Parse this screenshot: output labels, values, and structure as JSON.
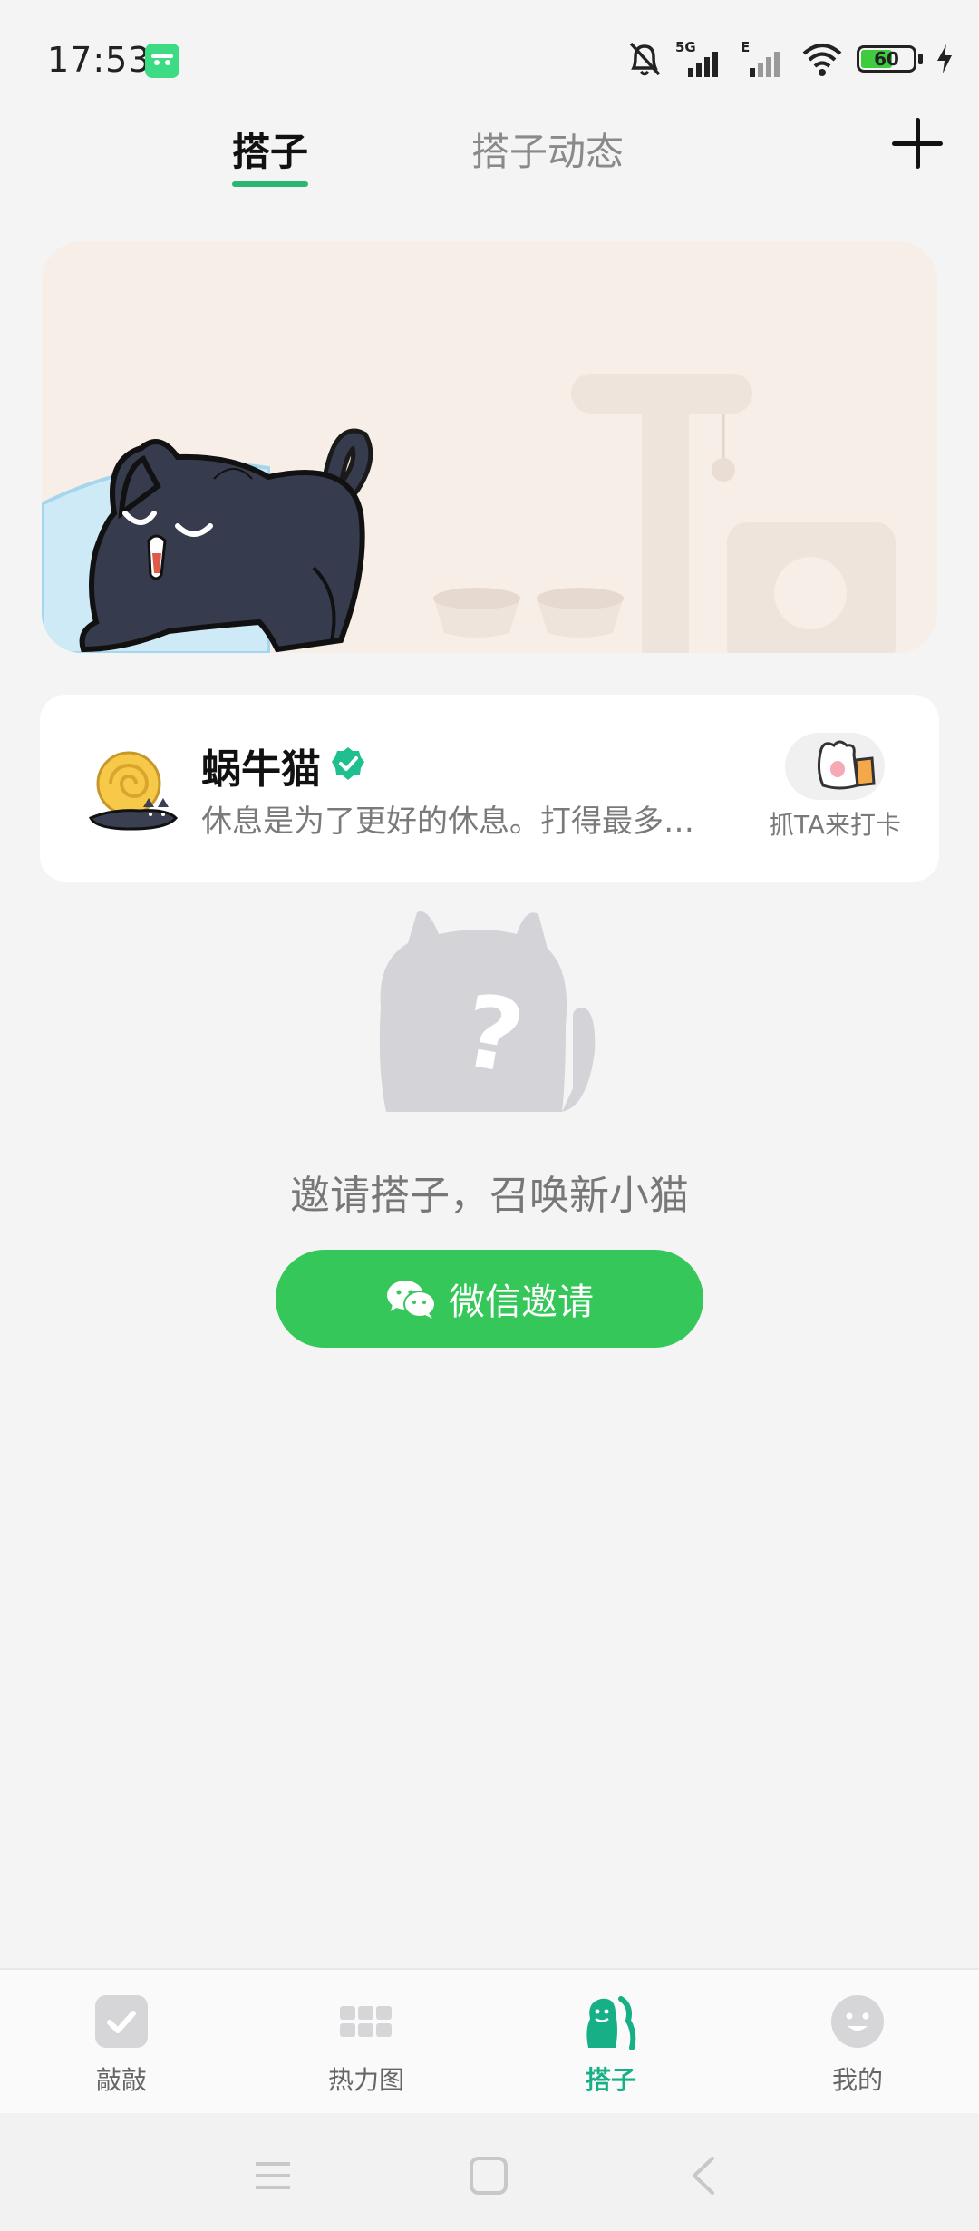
{
  "status_bar": {
    "time": "17:53",
    "battery": "60",
    "icons": [
      "android-icon",
      "mute-bell-icon",
      "signal-5g-icon",
      "signal-e-icon",
      "wifi-icon",
      "battery-icon",
      "charging-icon"
    ]
  },
  "tabs": [
    {
      "label": "搭子",
      "active": true
    },
    {
      "label": "搭子动态",
      "active": false
    }
  ],
  "add_icon": "plus-icon",
  "partner": {
    "name": "蜗牛猫",
    "description": "休息是为了更好的休息。打得最多…",
    "checkin_label": "抓TA来打卡"
  },
  "empty_state": {
    "invite_text": "邀请搭子，召唤新小猫",
    "button_label": "微信邀请"
  },
  "bottom_nav": [
    {
      "label": "敲敲",
      "icon": "check-icon",
      "active": false
    },
    {
      "label": "热力图",
      "icon": "grid-icon",
      "active": false
    },
    {
      "label": "搭子",
      "icon": "partner-icon",
      "active": true
    },
    {
      "label": "我的",
      "icon": "smiley-icon",
      "active": false
    }
  ],
  "colors": {
    "accent": "#2bb673",
    "wechat_green": "#35c759",
    "banner_bg": "#f7eee8",
    "active_nav": "#17b086"
  }
}
